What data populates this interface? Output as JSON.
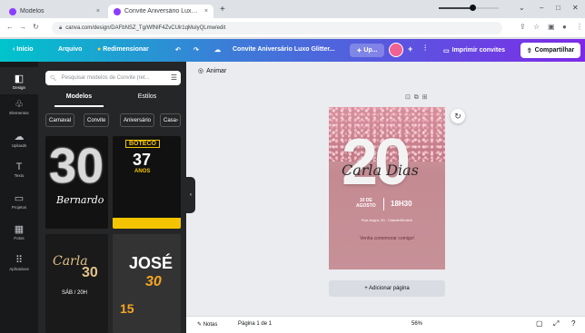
{
  "browser": {
    "tabs": [
      {
        "title": "Modelos",
        "close": "×"
      },
      {
        "title": "Convite Aniversário Luxo Glitter",
        "close": "×"
      }
    ],
    "new_tab": "+",
    "window_controls": [
      "⌄",
      "–",
      "□",
      "✕"
    ],
    "url": "canva.com/design/DAFbNSZ_Tg/WfNlF4ZvCUlr1qMulyQLmw/edit"
  },
  "topbar": {
    "home": "Início",
    "file": "Arquivo",
    "resize": "Redimensionar",
    "doc_title": "Convite Aniversário Luxo Glitter...",
    "upgrade": "Up...",
    "add": "+",
    "print": "Imprimir convites",
    "share": "Compartilhar"
  },
  "rail": [
    {
      "icon": "◧",
      "label": "Design"
    },
    {
      "icon": "♧",
      "label": "Elementos"
    },
    {
      "icon": "☁",
      "label": "Uploads"
    },
    {
      "icon": "T",
      "label": "Texto"
    },
    {
      "icon": "▭",
      "label": "Projetos"
    },
    {
      "icon": "▦",
      "label": "Fotos"
    },
    {
      "icon": "⠿",
      "label": "Aplicativos"
    }
  ],
  "panel": {
    "search_placeholder": "Pesquisar modelos de Convite (ret...",
    "tabs": [
      "Modelos",
      "Estilos"
    ],
    "chips": [
      "Carnaval",
      "Convite",
      "Aniversário",
      "Casa"
    ],
    "chip_more": "›",
    "thumbs": [
      {
        "big": "30",
        "script": "Bernardo"
      },
      {
        "header": "BOTECO",
        "big": "37",
        "sub": "ANOS"
      },
      {
        "script": "Carla",
        "big": "30",
        "sub": "SÁB / 20H"
      },
      {
        "name": "JOSÉ",
        "big": "30",
        "small": "15"
      }
    ]
  },
  "workspace": {
    "animate": "Animar",
    "design": {
      "number": "20",
      "name": "Carla Dias",
      "date_line1": "10 DE",
      "date_line2": "AGOSTO",
      "time": "18H30",
      "address": "Rua Angra, 00 - Cidade/Modelo",
      "note": "Venha comemorar comigo!"
    },
    "add_page": "+ Adicionar página"
  },
  "bottombar": {
    "notes": "Notas",
    "page_info": "Página 1 de 1",
    "zoom": "56%",
    "zoom_fraction": 0.56
  }
}
